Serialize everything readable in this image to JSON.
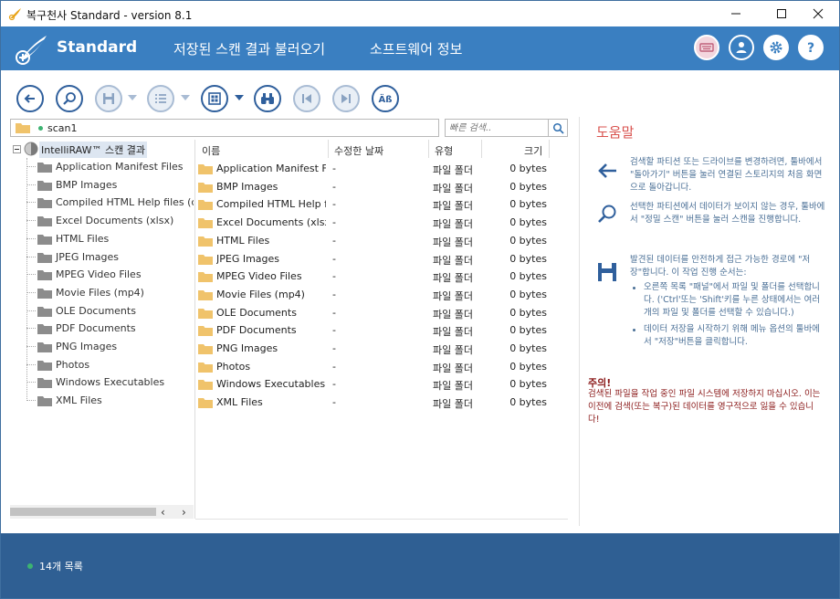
{
  "window": {
    "title": "복구천사 Standard - version 8.1"
  },
  "header": {
    "brand": "Standard",
    "nav": [
      "저장된 스캔 결과 불러오기",
      "소프트웨어 정보"
    ],
    "icons": [
      "keyboard-icon",
      "user-icon",
      "settings-icon",
      "help-icon"
    ]
  },
  "toolbar": {
    "buttons": [
      "back-icon",
      "deep-scan-icon",
      "save-icon",
      "list-view-icon",
      "grid-view-icon",
      "binoculars-icon",
      "previous-icon",
      "next-icon",
      "alphabet-icon"
    ]
  },
  "path": {
    "text": "scan1"
  },
  "search": {
    "placeholder": "빠른 검색.."
  },
  "tree": {
    "root": "IntelliRAW™ 스캔 결과",
    "items": [
      "Application Manifest Files",
      "BMP Images",
      "Compiled HTML Help files (chm)",
      "Excel Documents (xlsx)",
      "HTML Files",
      "JPEG Images",
      "MPEG Video Files",
      "Movie Files (mp4)",
      "OLE Documents",
      "PDF Documents",
      "PNG Images",
      "Photos",
      "Windows Executables",
      "XML Files"
    ]
  },
  "filelist": {
    "columns": {
      "name": "이름",
      "date": "수정한 날짜",
      "type": "유형",
      "size": "크기"
    },
    "rows": [
      {
        "name": "Application Manifest Files",
        "date": "-",
        "type": "파일 폴더",
        "size": "0 bytes"
      },
      {
        "name": "BMP Images",
        "date": "-",
        "type": "파일 폴더",
        "size": "0 bytes"
      },
      {
        "name": "Compiled HTML Help fil...",
        "date": "-",
        "type": "파일 폴더",
        "size": "0 bytes"
      },
      {
        "name": "Excel Documents (xlsx)",
        "date": "-",
        "type": "파일 폴더",
        "size": "0 bytes"
      },
      {
        "name": "HTML Files",
        "date": "-",
        "type": "파일 폴더",
        "size": "0 bytes"
      },
      {
        "name": "JPEG Images",
        "date": "-",
        "type": "파일 폴더",
        "size": "0 bytes"
      },
      {
        "name": "MPEG Video Files",
        "date": "-",
        "type": "파일 폴더",
        "size": "0 bytes"
      },
      {
        "name": "Movie Files (mp4)",
        "date": "-",
        "type": "파일 폴더",
        "size": "0 bytes"
      },
      {
        "name": "OLE Documents",
        "date": "-",
        "type": "파일 폴더",
        "size": "0 bytes"
      },
      {
        "name": "PDF Documents",
        "date": "-",
        "type": "파일 폴더",
        "size": "0 bytes"
      },
      {
        "name": "PNG Images",
        "date": "-",
        "type": "파일 폴더",
        "size": "0 bytes"
      },
      {
        "name": "Photos",
        "date": "-",
        "type": "파일 폴더",
        "size": "0 bytes"
      },
      {
        "name": "Windows Executables",
        "date": "-",
        "type": "파일 폴더",
        "size": "0 bytes"
      },
      {
        "name": "XML Files",
        "date": "-",
        "type": "파일 폴더",
        "size": "0 bytes"
      }
    ]
  },
  "help": {
    "title": "도움말",
    "back": "검색할 파티션 또는 드라이브를 변경하려면, 툴바에서 \"돌아가기\" 버튼을 눌러 연결된 스토리지의 처음 화면으로 돌아갑니다.",
    "scan": "선택한 파티션에서 데이터가 보이지 않는 경우, 툴바에서 \"정밀 스캔\" 버튼을 눌러 스캔을 진행합니다.",
    "save": "발견된 데이터를 안전하게 접근 가능한 경로에 \"저장\"합니다. 이 작업 진행 순서는:",
    "steps": [
      "오른쪽 목록 \"패널\"에서 파일 및 폴더를 선택합니다. ('Ctrl'또는 'Shift'키를 누른 상태에서는 여러개의 파일 및 폴더를 선택할 수 있습니다.)",
      "데이터 저장을 시작하기 위해 메뉴 옵션의 툴바에서 \"저장\"버튼을 클릭합니다."
    ],
    "warn_title": "주의!",
    "warn_text": "검색된 파일을 작업 중인 파일 시스템에 저장하지 마십시오. 이는 이전에 검색(또는 복구)된 데이터를 영구적으로 잃을 수 있습니다!"
  },
  "status": {
    "text": "14개 목록"
  },
  "colors": {
    "header": "#3a7fc1",
    "status": "#2f5f93",
    "accent": "#2f5f9c",
    "help_title": "#d9534f",
    "warning": "#8b1a1a"
  }
}
